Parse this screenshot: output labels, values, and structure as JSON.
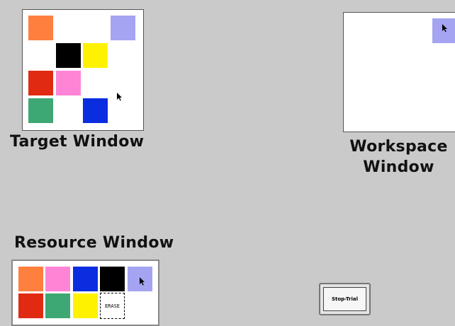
{
  "target_window": {
    "label": "Target Window",
    "tiles": [
      {
        "name": "orange",
        "color": "#ff7f3f"
      },
      {
        "name": "lavender",
        "color": "#a4a4f2"
      },
      {
        "name": "black",
        "color": "#000000"
      },
      {
        "name": "yellow",
        "color": "#fff200"
      },
      {
        "name": "red",
        "color": "#e02a12"
      },
      {
        "name": "pink",
        "color": "#ff84d6"
      },
      {
        "name": "green",
        "color": "#3ea874"
      },
      {
        "name": "blue",
        "color": "#0a2de0"
      }
    ]
  },
  "workspace_window": {
    "label_line1": "Workspace",
    "label_line2": "Window",
    "tiles": [
      {
        "name": "lavender",
        "color": "#a4a4f2"
      }
    ]
  },
  "resource_window": {
    "label": "Resource Window",
    "tiles": [
      {
        "name": "orange",
        "color": "#ff7f3f"
      },
      {
        "name": "pink",
        "color": "#ff84d6"
      },
      {
        "name": "blue",
        "color": "#0a2de0"
      },
      {
        "name": "black",
        "color": "#000000"
      },
      {
        "name": "lavender",
        "color": "#a4a4f2"
      },
      {
        "name": "red",
        "color": "#e02a12"
      },
      {
        "name": "green",
        "color": "#3ea874"
      },
      {
        "name": "yellow",
        "color": "#fff200"
      }
    ],
    "erase_label": "ERASE"
  },
  "stop_trial": {
    "label": "Stop-Trial"
  },
  "cursor_icon": "arrow-cursor-icon"
}
